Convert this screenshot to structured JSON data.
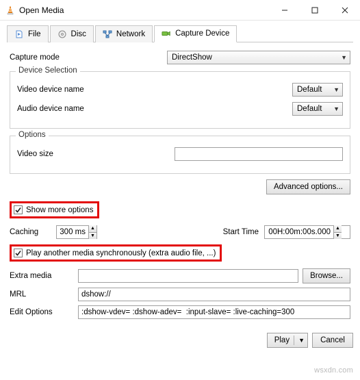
{
  "window": {
    "title": "Open Media"
  },
  "tabs": {
    "file": "File",
    "disc": "Disc",
    "network": "Network",
    "capture": "Capture Device"
  },
  "capture_mode": {
    "label": "Capture mode",
    "value": "DirectShow"
  },
  "device_selection": {
    "legend": "Device Selection",
    "video_label": "Video device name",
    "video_value": "Default",
    "audio_label": "Audio device name",
    "audio_value": "Default"
  },
  "options_group": {
    "legend": "Options",
    "video_size_label": "Video size",
    "video_size_value": ""
  },
  "advanced_button": "Advanced options...",
  "show_more": {
    "label": "Show more options"
  },
  "caching": {
    "label": "Caching",
    "value": "300 ms"
  },
  "start_time": {
    "label": "Start Time",
    "value": "00H:00m:00s.000"
  },
  "play_another": {
    "label": "Play another media synchronously (extra audio file, ...)"
  },
  "extra_media": {
    "label": "Extra media",
    "value": "",
    "browse": "Browse..."
  },
  "mrl": {
    "label": "MRL",
    "value": "dshow://"
  },
  "edit_options": {
    "label": "Edit Options",
    "value": ":dshow-vdev= :dshow-adev=  :input-slave= :live-caching=300"
  },
  "footer": {
    "play": "Play",
    "cancel": "Cancel"
  },
  "watermark": "wsxdn.com"
}
